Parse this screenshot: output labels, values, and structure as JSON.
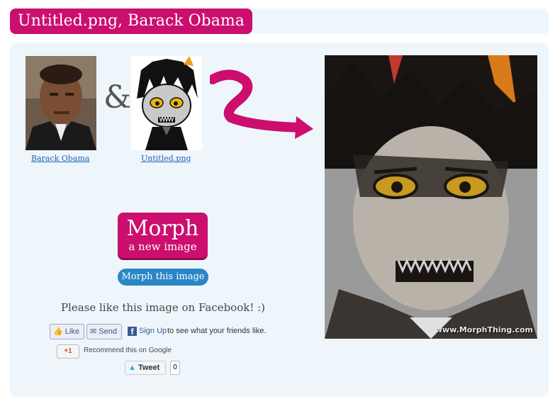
{
  "header": {
    "title": "Untitled.png, Barack Obama"
  },
  "sources": [
    {
      "label": "Barack Obama"
    },
    {
      "label": "Untitled.png"
    }
  ],
  "ampersand": "&",
  "result": {
    "watermark": "www.MorphThing.com"
  },
  "actions": {
    "morph_big": "Morph",
    "morph_small": "a new image",
    "morph_this": "Morph this image"
  },
  "facebook": {
    "prompt": "Please like this image on Facebook! :)",
    "like_label": "Like",
    "send_label": "Send",
    "signup_label": "Sign Up",
    "signup_rest": "to see what your friends like."
  },
  "google": {
    "button_label": "+1",
    "text": "Recommend this on Google"
  },
  "twitter": {
    "tweet_label": "Tweet",
    "count": "0"
  },
  "colors": {
    "accent": "#cc0e6f",
    "panel": "#eef6fc",
    "button_blue": "#2a86c6"
  }
}
